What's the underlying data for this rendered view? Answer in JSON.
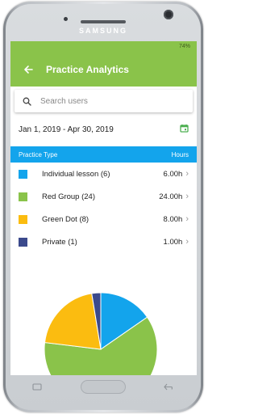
{
  "device": {
    "brand": "SAMSUNG"
  },
  "status": {
    "battery_text": "74%"
  },
  "appbar": {
    "title": "Practice Analytics"
  },
  "search": {
    "placeholder": "Search users"
  },
  "date_range": "Jan 1, 2019 - Apr 30, 2019",
  "table": {
    "header_type": "Practice Type",
    "header_hours": "Hours",
    "rows": [
      {
        "name": "Individual lesson (6)",
        "hours": "6.00h",
        "color": "#13a4ec"
      },
      {
        "name": "Red Group (24)",
        "hours": "24.00h",
        "color": "#8ac34a"
      },
      {
        "name": "Green Dot (8)",
        "hours": "8.00h",
        "color": "#fbbc10"
      },
      {
        "name": "Private (1)",
        "hours": "1.00h",
        "color": "#3b4a8c"
      }
    ]
  },
  "chart_data": {
    "type": "pie",
    "slices": [
      {
        "label": "Individual lesson (6)",
        "value": 6,
        "color": "#13a4ec"
      },
      {
        "label": "Red Group (24)",
        "value": 24,
        "color": "#8ac34a"
      },
      {
        "label": "Green Dot (8)",
        "value": 8,
        "color": "#fbbc10"
      },
      {
        "label": "Private (1)",
        "value": 1,
        "color": "#3b4a8c"
      }
    ]
  },
  "colors": {
    "appbar": "#8ac34a",
    "table_header": "#13a4ec",
    "accent_calendar": "#4caf50"
  }
}
